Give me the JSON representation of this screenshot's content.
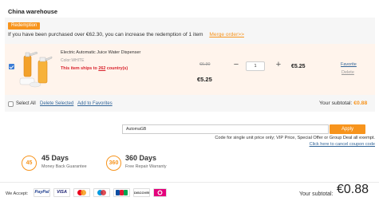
{
  "warehouse": {
    "title": "China warehouse",
    "redemption_tag": "Redemption",
    "redemption_message": "If you have been purchased over €62.30, you can increase the redemption of 1 item",
    "merge_order_link": "Merge order>>"
  },
  "item": {
    "name": "Electric Automatic Juice Water Dispenser",
    "color": "Color:WHITE",
    "ships_prefix": "This item ships to ",
    "ships_count": "262",
    "ships_suffix": " country(s)",
    "old_price": "€6.30",
    "unit_price": "€5.25",
    "quantity": "1",
    "qty_minus": "−",
    "qty_plus": "+",
    "subtotal": "€5.25",
    "favorite_label": "Favorite",
    "delete_label": "Delete",
    "checked": true
  },
  "bulk": {
    "select_all": "Select All",
    "delete_selected": "Delete Selected",
    "add_favorites": "Add to Favorites",
    "subtotal_label": "Your subtotal: ",
    "subtotal_amount": "€0.88"
  },
  "coupon": {
    "value": "AutomaGB",
    "apply_label": "Apply",
    "note": "Code for single unit price only; VIP Price, Special Offer or Group Deal all exempt.",
    "cancel_link": "Click here to cancel coupon code"
  },
  "guarantees": [
    {
      "number": "45",
      "title": "45 Days",
      "subtitle": "Money Back Guarantee"
    },
    {
      "number": "360",
      "title": "360 Days",
      "subtitle": "Free Repair Warranty"
    }
  ],
  "footer": {
    "we_accept": "We Accept:",
    "payment_methods": [
      {
        "name": "PayPal",
        "icon": "paypal-icon"
      },
      {
        "name": "VISA",
        "icon": "visa-icon"
      },
      {
        "name": "",
        "icon": "mastercard-icon"
      },
      {
        "name": "",
        "icon": "maestro-icon"
      },
      {
        "name": "JCB",
        "icon": "jcb-icon"
      },
      {
        "name": "DISCOVER",
        "icon": "discover-icon"
      },
      {
        "name": "",
        "icon": "dinersclub-icon"
      }
    ],
    "grand_label": "Your subtotal:",
    "grand_amount": "€0.88"
  },
  "colors": {
    "accent": "#f7941d",
    "link": "#336699",
    "alert": "#d9232d",
    "row_highlight": "#fff4ec"
  }
}
